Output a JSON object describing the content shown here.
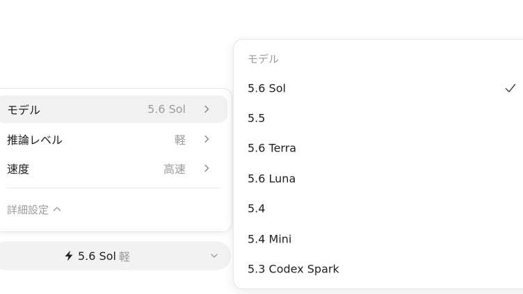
{
  "settings_panel": {
    "rows": [
      {
        "label": "モデル",
        "value": "5.6 Sol"
      },
      {
        "label": "推論レベル",
        "value": "軽"
      },
      {
        "label": "速度",
        "value": "高速"
      }
    ],
    "advanced": {
      "label": "詳細設定",
      "icon": "chevron-up-icon"
    },
    "row_icon": "chevron-right-icon"
  },
  "model_pill": {
    "icon": "lightning-icon",
    "model": "5.6 Sol",
    "speed": "軽",
    "dropdown_icon": "chevron-down-icon"
  },
  "model_menu": {
    "header": "モデル",
    "items": [
      {
        "label": "5.6 Sol",
        "selected": true
      },
      {
        "label": "5.5",
        "selected": false
      },
      {
        "label": "5.6 Terra",
        "selected": false
      },
      {
        "label": "5.6 Luna",
        "selected": false
      },
      {
        "label": "5.4",
        "selected": false
      },
      {
        "label": "5.4 Mini",
        "selected": false
      },
      {
        "label": "5.3 Codex Spark",
        "selected": false
      }
    ],
    "selected_icon": "checkmark-icon"
  },
  "colors": {
    "primary_text": "#1e1e1e",
    "secondary_text": "#9a9a9a",
    "row_highlight": "#f1f1f1",
    "pill_background": "#f2f2f2",
    "border": "#e6e6e6"
  }
}
